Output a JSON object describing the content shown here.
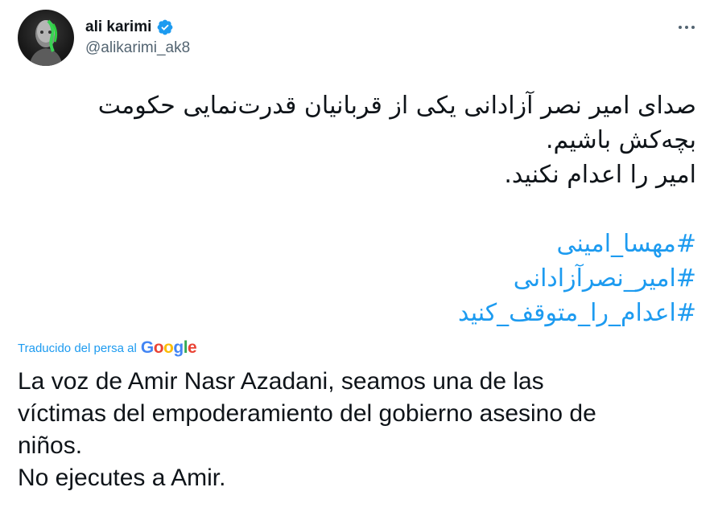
{
  "author": {
    "name": "ali karimi",
    "handle": "@alikarimi_ak8",
    "verified": true,
    "avatar": "avatar-portrait-green-paint"
  },
  "more_icon": "more-horizontal-icon",
  "tweet": {
    "lines": [
      "صدای امیر نصر آزادانی یکی از قربانیان قدرت‌نمایی حکومت",
      "بچه‌کش باشیم.",
      "امیر را اعدام نکنید."
    ],
    "hashtags": [
      "#مهسا_امینی",
      "#امیر_نصرآزادانی",
      "#اعدام_را_متوقف_کنید"
    ]
  },
  "translation": {
    "label": "Traducido del persa al",
    "provider": "Google",
    "lines": [
      "La voz de Amir Nasr Azadani, seamos una de las",
      "víctimas del empoderamiento del gobierno asesino de",
      "niños.",
      "No ejecutes a Amir."
    ]
  },
  "colors": {
    "link": "#1d9bf0",
    "text": "#0f1419",
    "secondary": "#536471",
    "verified": "#1d9bf0"
  }
}
